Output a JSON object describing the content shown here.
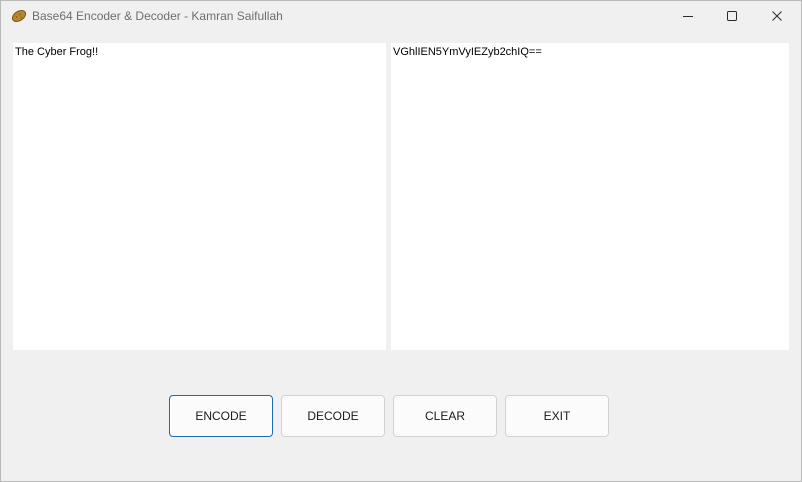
{
  "window": {
    "title": "Base64 Encoder & Decoder - Kamran Saifullah",
    "icon": "potato-icon",
    "controls": {
      "minimize": "minimize-icon",
      "maximize": "maximize-icon",
      "close": "close-icon"
    }
  },
  "main": {
    "input_text": "The Cyber Frog!!",
    "output_text": "VGhlIEN5YmVyIEZyb2chIQ=="
  },
  "buttons": {
    "encode": "ENCODE",
    "decode": "DECODE",
    "clear": "CLEAR",
    "exit": "EXIT"
  },
  "colors": {
    "window_bg": "#f0f0f0",
    "textbox_bg": "#ffffff",
    "default_button_border": "#1b6bb5",
    "title_text": "#6e6e6e"
  }
}
